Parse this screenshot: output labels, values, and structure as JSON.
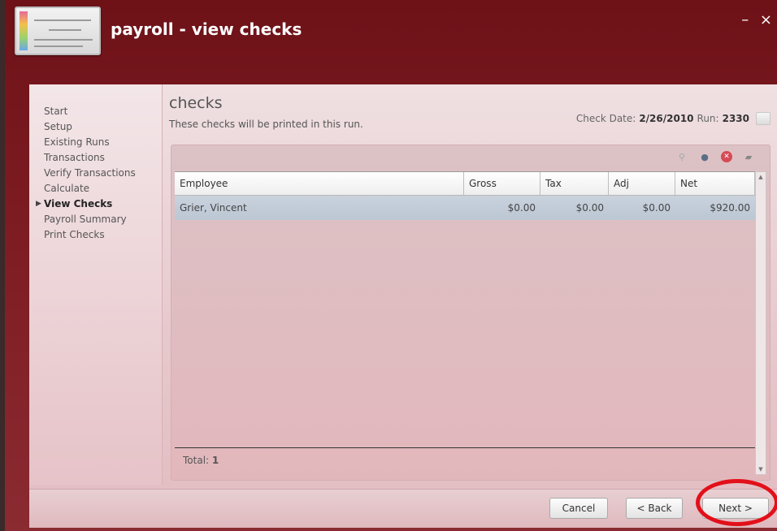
{
  "window": {
    "title": "payroll - view checks",
    "controls": "– ×"
  },
  "nav": {
    "items": [
      {
        "label": "Start",
        "active": false
      },
      {
        "label": "Setup",
        "active": false
      },
      {
        "label": "Existing Runs",
        "active": false
      },
      {
        "label": "Transactions",
        "active": false
      },
      {
        "label": "Verify Transactions",
        "active": false
      },
      {
        "label": "Calculate",
        "active": false
      },
      {
        "label": "View Checks",
        "active": true
      },
      {
        "label": "Payroll Summary",
        "active": false
      },
      {
        "label": "Print Checks",
        "active": false
      }
    ]
  },
  "main": {
    "heading": "checks",
    "subtitle": "These checks will be printed in this run.",
    "check_date_label": "Check Date:",
    "check_date": "2/26/2010",
    "run_label": "Run:",
    "run": "2330"
  },
  "grid": {
    "columns": [
      "Employee",
      "Gross",
      "Tax",
      "Adj",
      "Net"
    ],
    "rows": [
      {
        "employee": "Grier, Vincent",
        "gross": "$0.00",
        "tax": "$0.00",
        "adj": "$0.00",
        "net": "$920.00"
      }
    ],
    "total_label": "Total:",
    "total": "1"
  },
  "buttons": {
    "cancel": "Cancel",
    "back": "< Back",
    "next": "Next >"
  },
  "colors": {
    "title_bar": "#6e1218",
    "highlight_ring": "#e2101a",
    "selected_row": "#c2ccd8"
  }
}
